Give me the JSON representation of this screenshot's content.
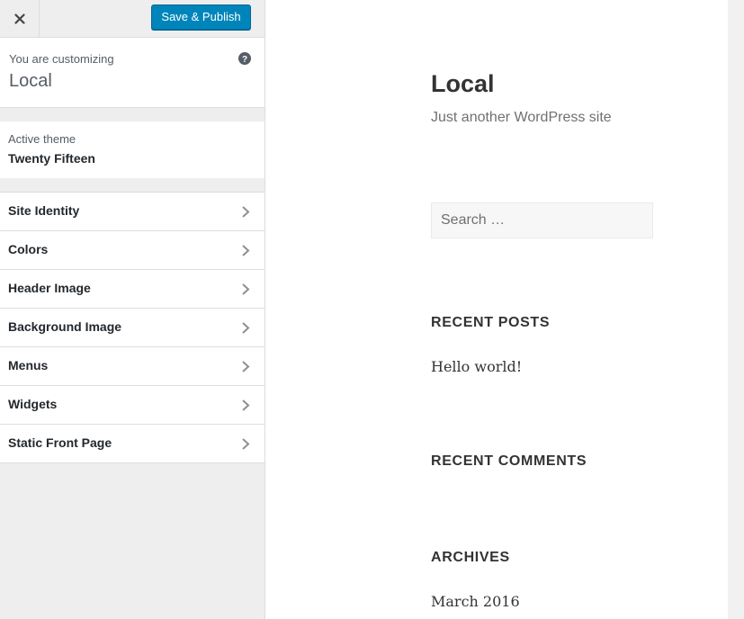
{
  "header": {
    "close_icon": "close-icon",
    "publish_label": "Save & Publish",
    "publish_color": "#0085ba"
  },
  "info": {
    "label": "You are customizing",
    "title": "Local",
    "help_icon": "question-icon"
  },
  "theme": {
    "label": "Active theme",
    "name": "Twenty Fifteen"
  },
  "sections": [
    {
      "label": "Site Identity"
    },
    {
      "label": "Colors"
    },
    {
      "label": "Header Image"
    },
    {
      "label": "Background Image"
    },
    {
      "label": "Menus"
    },
    {
      "label": "Widgets"
    },
    {
      "label": "Static Front Page"
    }
  ],
  "preview": {
    "site_title": "Local",
    "site_description": "Just another WordPress site",
    "search_placeholder": "Search …",
    "widgets": {
      "recent_posts_title": "RECENT POSTS",
      "recent_posts": [
        "Hello world!"
      ],
      "recent_comments_title": "RECENT COMMENTS",
      "archives_title": "ARCHIVES",
      "archives": [
        "March 2016"
      ]
    }
  }
}
